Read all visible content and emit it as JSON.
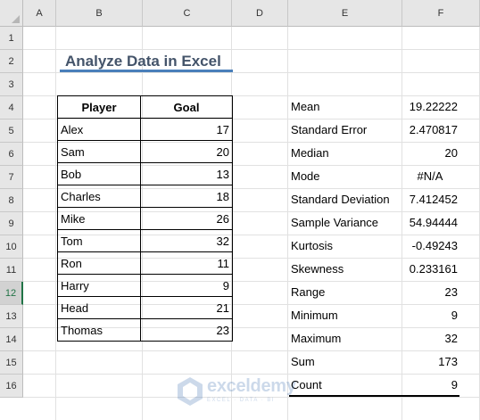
{
  "columns": [
    "A",
    "B",
    "C",
    "D",
    "E",
    "F"
  ],
  "rows": [
    "1",
    "2",
    "3",
    "4",
    "5",
    "6",
    "7",
    "8",
    "9",
    "10",
    "11",
    "12",
    "13",
    "14",
    "15",
    "16"
  ],
  "title": "Analyze Data in Excel",
  "table": {
    "headers": [
      "Player",
      "Goal"
    ],
    "rows": [
      {
        "player": "Alex",
        "goal": "17"
      },
      {
        "player": "Sam",
        "goal": "20"
      },
      {
        "player": "Bob",
        "goal": "13"
      },
      {
        "player": "Charles",
        "goal": "18"
      },
      {
        "player": "Mike",
        "goal": "26"
      },
      {
        "player": "Tom",
        "goal": "32"
      },
      {
        "player": "Ron",
        "goal": "11"
      },
      {
        "player": "Harry",
        "goal": "9"
      },
      {
        "player": "Head",
        "goal": "21"
      },
      {
        "player": "Thomas",
        "goal": "23"
      }
    ]
  },
  "stats": [
    {
      "label": "Mean",
      "value": "19.22222"
    },
    {
      "label": "Standard Error",
      "value": "2.470817"
    },
    {
      "label": "Median",
      "value": "20"
    },
    {
      "label": "Mode",
      "value": "#N/A"
    },
    {
      "label": "Standard Deviation",
      "value": "7.412452"
    },
    {
      "label": "Sample Variance",
      "value": "54.94444"
    },
    {
      "label": "Kurtosis",
      "value": "-0.49243"
    },
    {
      "label": "Skewness",
      "value": "0.233161"
    },
    {
      "label": "Range",
      "value": "23"
    },
    {
      "label": "Minimum",
      "value": "9"
    },
    {
      "label": "Maximum",
      "value": "32"
    },
    {
      "label": "Sum",
      "value": "173"
    },
    {
      "label": "Count",
      "value": "9"
    }
  ],
  "watermark": {
    "brand": "exceldemy",
    "tagline": "EXCEL · DATA · BI"
  },
  "active_row": "12",
  "colors": {
    "title": "#44546a",
    "title_underline": "#4a7fba",
    "active_header": "#217346"
  }
}
